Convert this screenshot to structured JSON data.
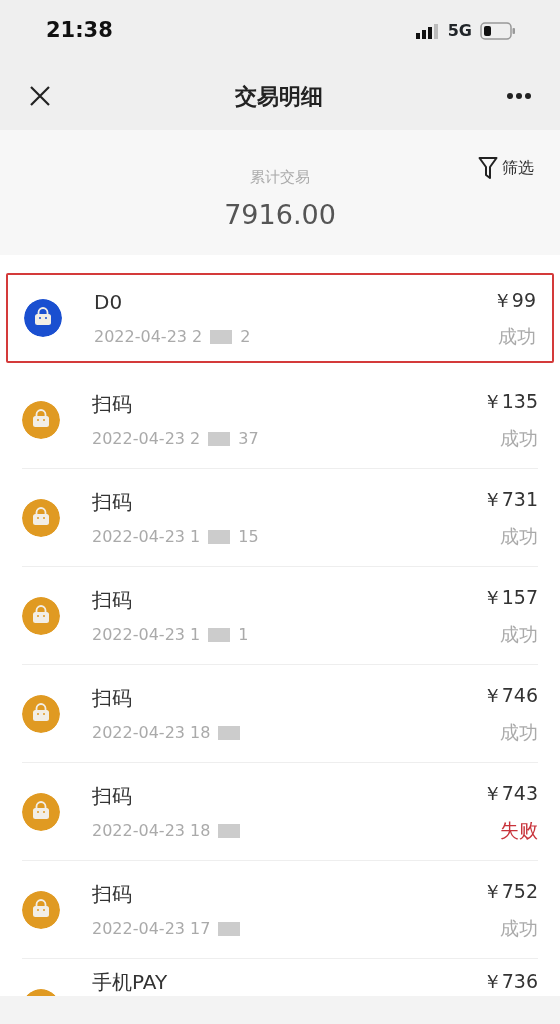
{
  "status_bar": {
    "time": "21:38",
    "network": "5G"
  },
  "nav": {
    "title": "交易明细"
  },
  "summary": {
    "label": "累计交易",
    "total": "7916.00",
    "filter": "筛选"
  },
  "transactions": [
    {
      "name": "D0",
      "time": "2022-04-23 2",
      "time_end": "2",
      "amount": "￥99",
      "status": "成功",
      "kind": "success",
      "color": "#1a4fd0",
      "highlighted": true
    },
    {
      "name": "扫码",
      "time": "2022-04-23 2",
      "time_end": "37",
      "amount": "￥135",
      "status": "成功",
      "kind": "success",
      "color": "#e09a22",
      "highlighted": false
    },
    {
      "name": "扫码",
      "time": "2022-04-23 1",
      "time_end": "15",
      "amount": "￥731",
      "status": "成功",
      "kind": "success",
      "color": "#e09a22",
      "highlighted": false
    },
    {
      "name": "扫码",
      "time": "2022-04-23 1",
      "time_end": "1",
      "amount": "￥157",
      "status": "成功",
      "kind": "success",
      "color": "#e09a22",
      "highlighted": false
    },
    {
      "name": "扫码",
      "time": "2022-04-23 18",
      "amount": "￥746",
      "status": "成功",
      "kind": "success",
      "color": "#e09a22",
      "highlighted": false
    },
    {
      "name": "扫码",
      "time": "2022-04-23 18",
      "amount": "￥743",
      "status": "失败",
      "kind": "failure",
      "color": "#e09a22",
      "highlighted": false
    },
    {
      "name": "扫码",
      "time": "2022-04-23 17",
      "amount": "￥752",
      "status": "成功",
      "kind": "success",
      "color": "#e09a22",
      "highlighted": false
    },
    {
      "name": "手机PAY",
      "amount": "￥736",
      "color": "#e09a22",
      "highlighted": false
    }
  ]
}
